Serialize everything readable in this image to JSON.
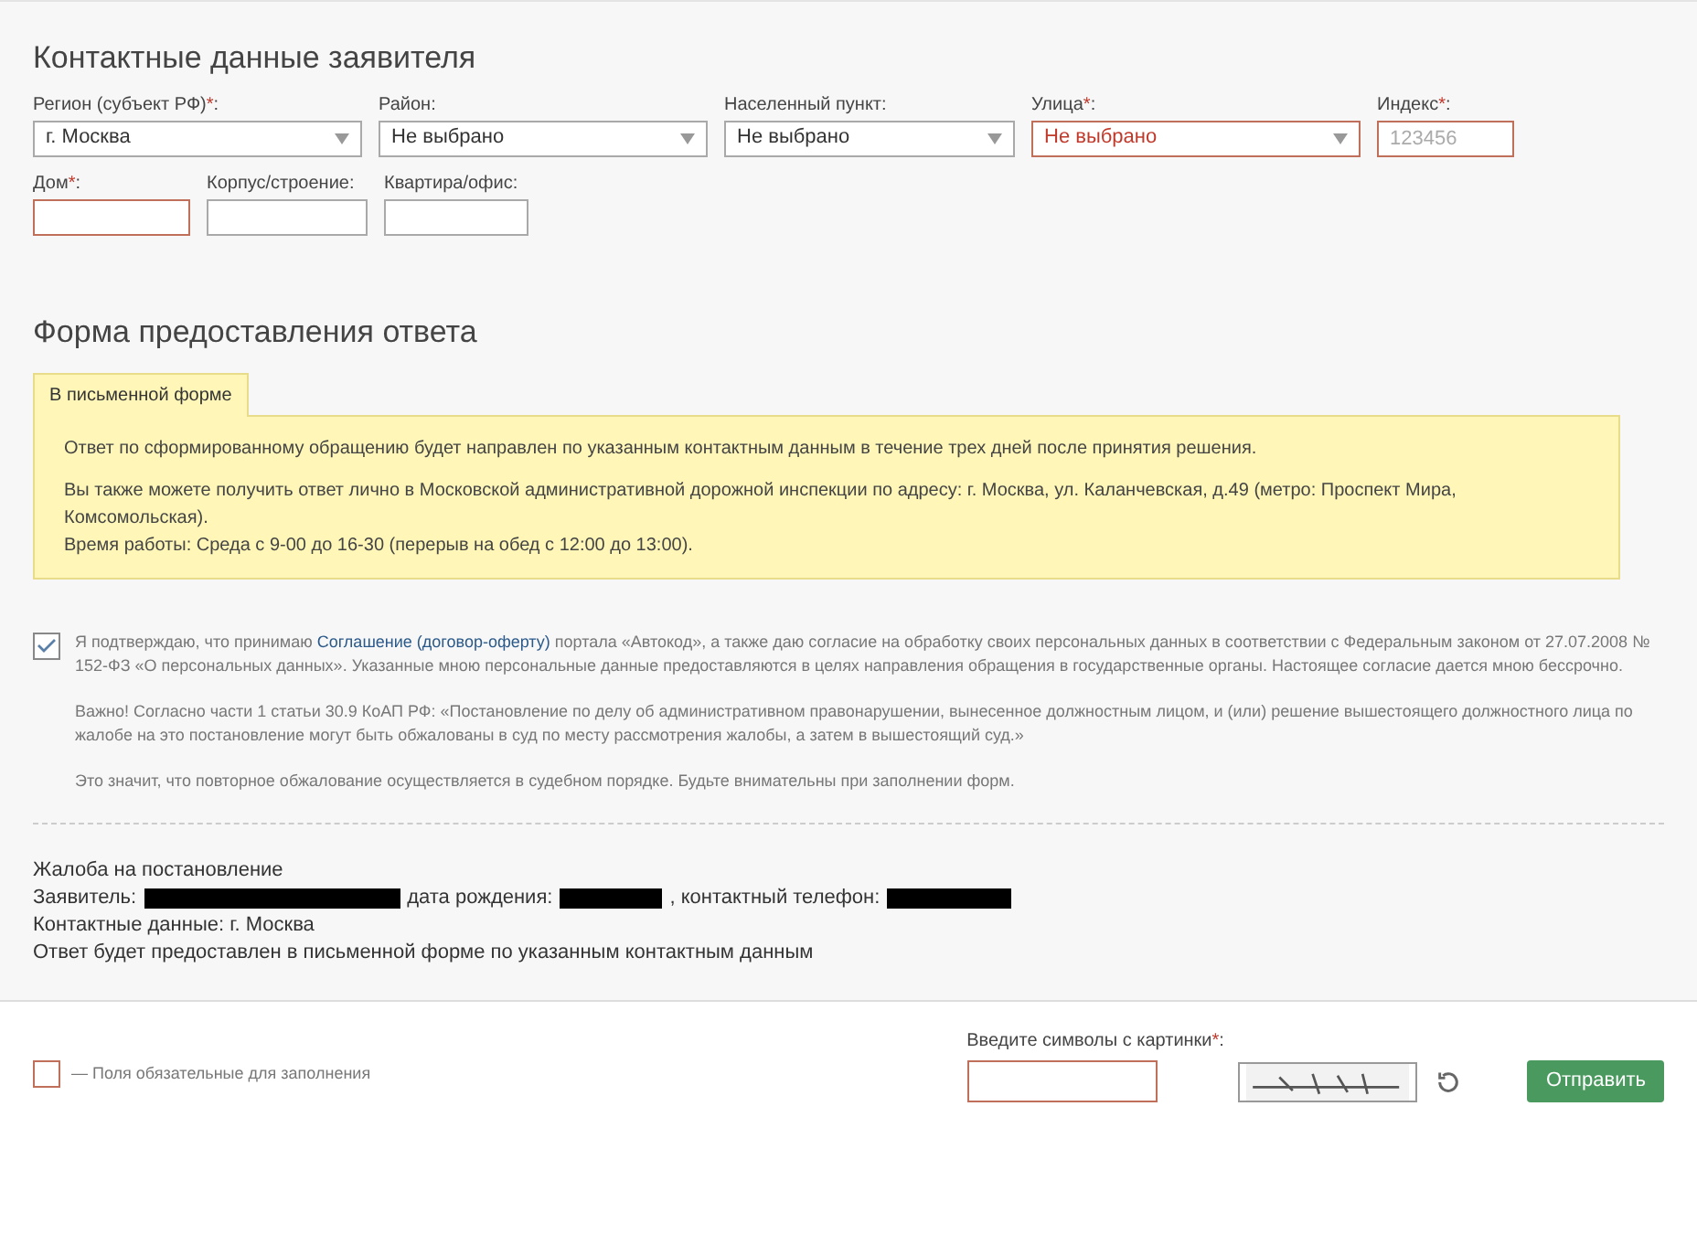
{
  "contacts": {
    "title": "Контактные данные заявителя",
    "field_groups": [
      {
        "fields": [
          {
            "kind": "select",
            "label": "Регион (субъект РФ)",
            "required_mark": "*",
            "label_end": ":",
            "value": "г. Москва",
            "error": false
          },
          {
            "kind": "select",
            "label": "Район",
            "label_end": ":",
            "value": "Не выбрано",
            "error": false
          },
          {
            "kind": "select",
            "label": "Населенный пункт",
            "label_end": ":",
            "value": "Не выбрано",
            "error": false
          },
          {
            "kind": "select",
            "label": "Улица",
            "required_mark": "*",
            "label_end": ":",
            "value": "Не выбрано",
            "error": true
          },
          {
            "kind": "input",
            "label": "Индекс",
            "required_mark": "*",
            "label_end": ":",
            "placeholder": "123456",
            "error": true
          }
        ]
      },
      {
        "fields": [
          {
            "kind": "input",
            "label": "Дом",
            "required_mark": "*",
            "label_end": ":",
            "error": true
          },
          {
            "kind": "input",
            "label": "Корпус/строение",
            "label_end": ":",
            "error": false
          },
          {
            "kind": "input",
            "label": "Квартира/офис",
            "label_end": ":",
            "error": false
          }
        ]
      }
    ]
  },
  "answer_form": {
    "title": "Форма предоставления ответа",
    "tabs": [
      {
        "label": "В письменной форме",
        "selected": true
      }
    ],
    "paragraphs": [
      [
        "Ответ по сформированному обращению будет направлен по указанным контактным данным в течение трех дней после принятия решения."
      ],
      [
        "Вы также можете получить ответ лично в Московской административной дорожной инспекции по адресу: г. Москва, ул. Каланчевская, д.49 (метро: Проспект Мира, Комсомольская).",
        "Время работы: Среда с 9-00 до 16-30 (перерыв на обед с 12:00 до 13:00)."
      ]
    ]
  },
  "consent": {
    "checked": true,
    "before": "Я подтверждаю, что принимаю ",
    "link": "Соглашение (договор-оферту)",
    "after": " портала «Автокод», а также даю согласие на обработку своих персональных данных в соответствии с Федеральным законом от 27.07.2008 № 152-ФЗ «О персональных данных». Указанные мною персональные данные предоставляются в целях направления обращения в государственные органы. Настоящее согласие дается мною бессрочно.",
    "notes": [
      "Важно! Согласно части 1 статьи 30.9 КоАП РФ: «Постановление по делу об административном правонарушении, вынесенное должностным лицом, и (или) решение вышестоящего должностного лица по жалобе на это постановление могут быть обжалованы в суд по месту рассмотрения жалобы, а затем в вышестоящий суд.»",
      "Это значит, что повторное обжалование осуществляется в судебном порядке. Будьте внимательны при заполнении форм."
    ]
  },
  "summary": {
    "lines": [
      [
        {
          "kind": "text",
          "text": "Жалоба на постановление"
        }
      ],
      [
        {
          "kind": "text",
          "text": "Заявитель:"
        },
        {
          "kind": "redacted"
        },
        {
          "kind": "text",
          "text": "дата рождения:"
        },
        {
          "kind": "redacted"
        },
        {
          "kind": "text",
          "text": ", контактный телефон:"
        },
        {
          "kind": "redacted"
        }
      ],
      [
        {
          "kind": "text",
          "text": "Контактные данные: г. Москва"
        }
      ],
      [
        {
          "kind": "text",
          "text": "Ответ будет предоставлен в письменной форме по указанным контактным данным"
        }
      ]
    ]
  },
  "footer": {
    "legend": "— Поля обязательные для заполнения",
    "captcha": {
      "label": "Введите символы с картинки",
      "required_mark": "*",
      "label_end": ":",
      "error": true
    },
    "submit": "Отправить"
  }
}
